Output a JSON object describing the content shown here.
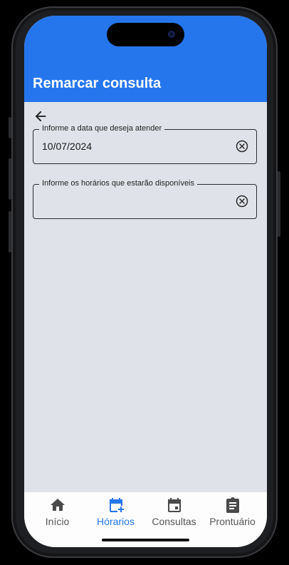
{
  "appbar": {
    "title": "Remarcar consulta"
  },
  "form": {
    "date_field": {
      "label": "Informe a data que deseja atender",
      "value": "10/07/2024"
    },
    "times_field": {
      "label": "Informe os horários que estarão disponíveis",
      "value": ""
    }
  },
  "bottom_nav": {
    "items": [
      {
        "label": "Início",
        "icon": "home-icon"
      },
      {
        "label": "Hórarios",
        "icon": "calendar-add-icon",
        "active": true
      },
      {
        "label": "Consultas",
        "icon": "calendar-event-icon"
      },
      {
        "label": "Prontuário",
        "icon": "clipboard-icon"
      }
    ]
  },
  "colors": {
    "primary": "#2576ed",
    "background": "#dfe2e8",
    "inactive_nav": "#555555"
  }
}
